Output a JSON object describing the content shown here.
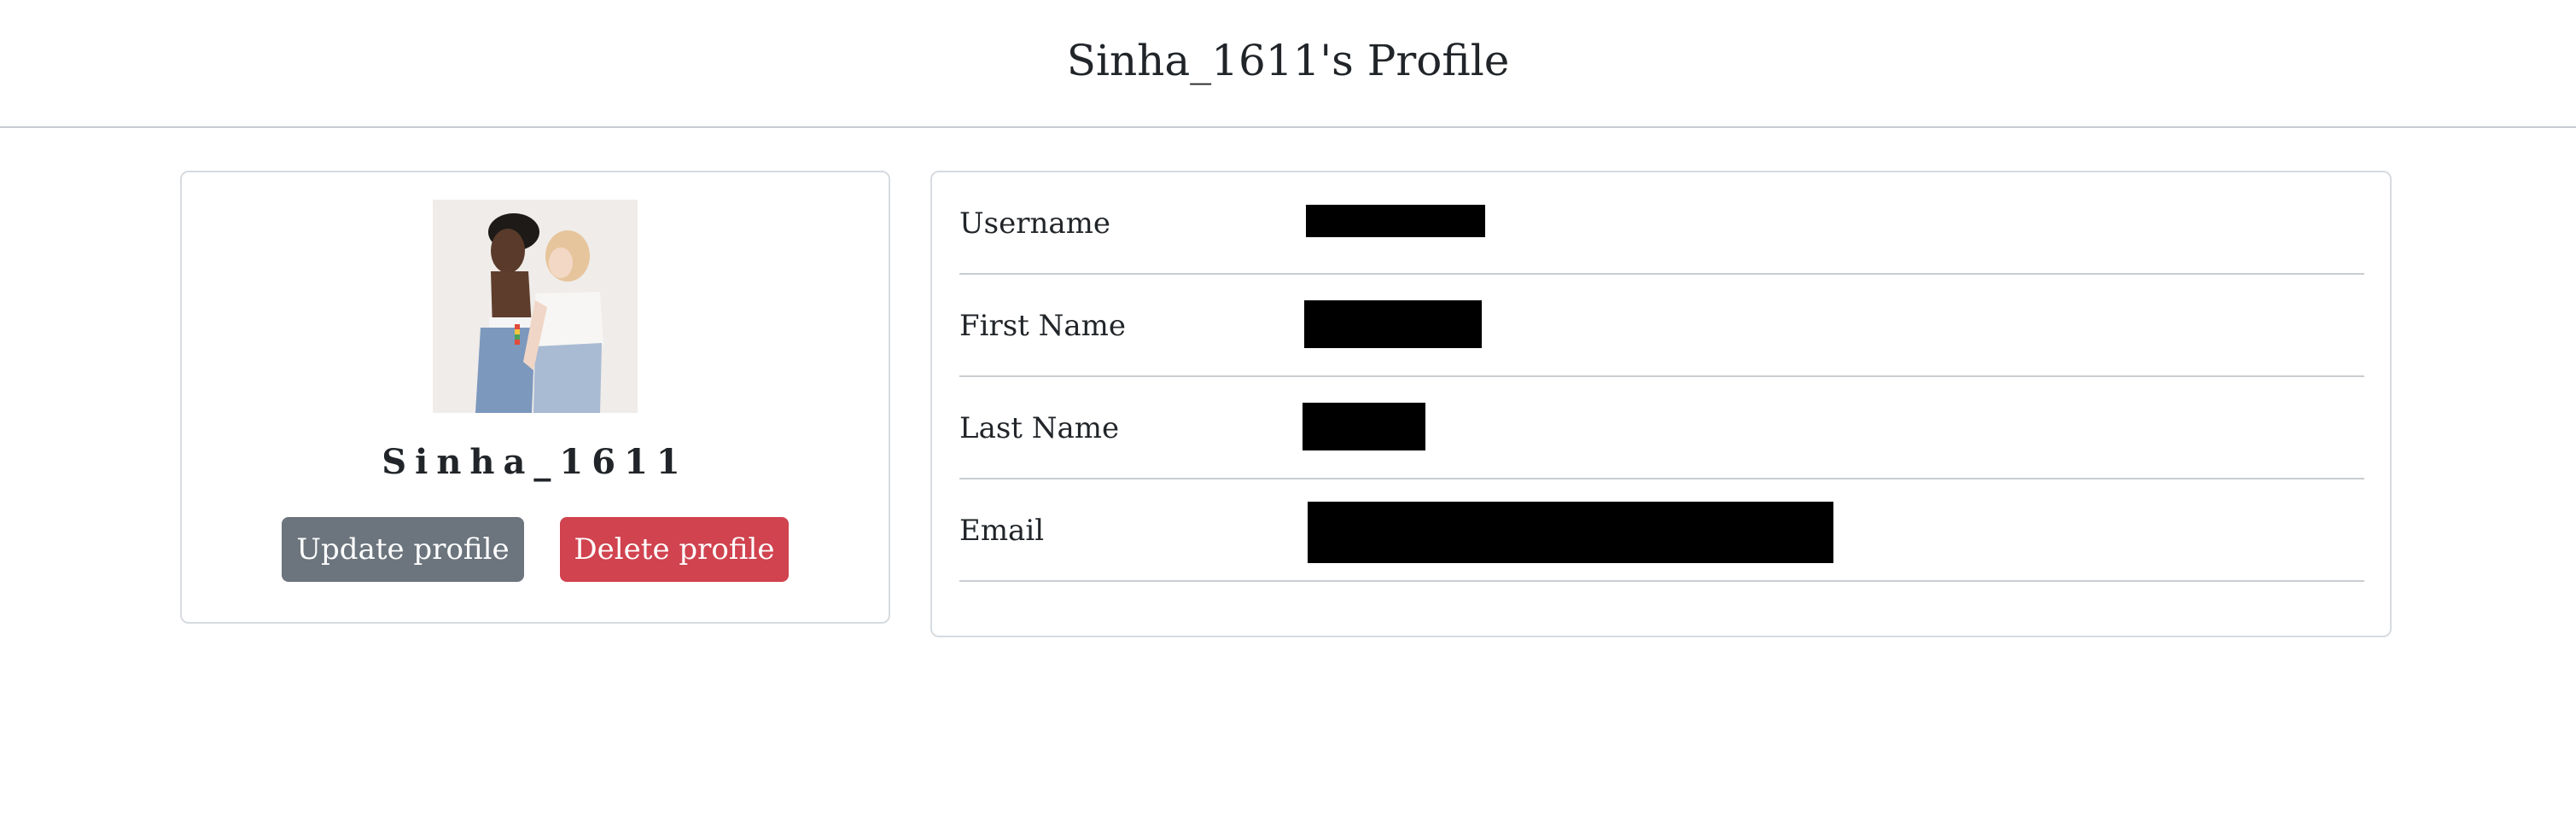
{
  "page": {
    "title": "Sinha_1611's Profile"
  },
  "profile": {
    "display_name": "Sinha_1611",
    "avatar_alt": "profile picture",
    "update_label": "Update profile",
    "delete_label": "Delete profile"
  },
  "details": {
    "rows": [
      {
        "label": "Username",
        "value": "[redacted]"
      },
      {
        "label": "First Name",
        "value": "[redacted]"
      },
      {
        "label": "Last Name",
        "value": "[redacted]"
      },
      {
        "label": "Email",
        "value": "[redacted]"
      }
    ]
  },
  "colors": {
    "update_button": "#6c757d",
    "delete_button": "#d0434f",
    "border": "#d7dbdf",
    "text": "#212529"
  }
}
